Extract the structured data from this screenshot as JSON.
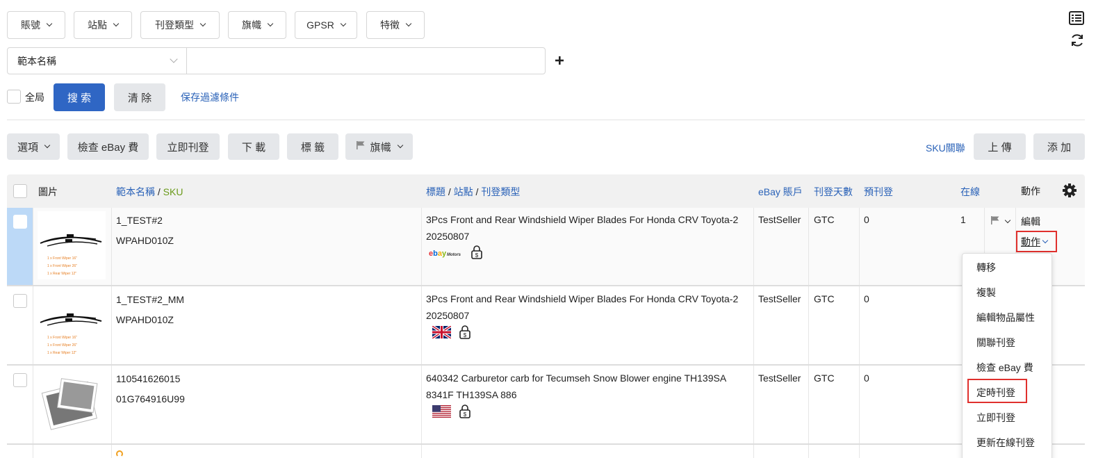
{
  "filters": {
    "dropdowns": [
      {
        "label": "賬號"
      },
      {
        "label": "站點"
      },
      {
        "label": "刊登類型"
      },
      {
        "label": "旗幟"
      },
      {
        "label": "GPSR"
      },
      {
        "label": "特徵"
      }
    ],
    "field_select": "範本名稱",
    "field_value": "",
    "global_label": "全局",
    "search_label": "搜 索",
    "clear_label": "清 除",
    "save_filter_label": "保存過濾條件"
  },
  "toolbar": {
    "options_label": "選項",
    "check_fee_label": "檢查 eBay 費",
    "publish_now_label": "立即刊登",
    "download_label": "下 載",
    "tag_label": "標 籤",
    "flag_label": "旗幟",
    "sku_link_label": "SKU關聯",
    "upload_label": "上 傳",
    "add_label": "添 加"
  },
  "table": {
    "headers": {
      "image": "圖片",
      "template": "範本名稱",
      "sep1": " / ",
      "sku": "SKU",
      "title": "標題",
      "sep2": " / ",
      "site": "站點",
      "sep3": " / ",
      "type": "刊登類型",
      "account": "eBay 賬戶",
      "days": "刊登天數",
      "pre": "預刊登",
      "online": "在線",
      "action": "動作"
    },
    "rows": [
      {
        "template": "1_TEST#2",
        "sku": "WPAHD010Z",
        "title": "3Pcs Front and Rear Windshield Wiper Blades For Honda CRV Toyota-2",
        "title2": "20250807",
        "site_icon": "ebay-motors-icon",
        "account": "TestSeller",
        "days": "GTC",
        "pre": "0",
        "online": "1",
        "edit": "編輯",
        "action": "動作"
      },
      {
        "template": "1_TEST#2_MM",
        "sku": "WPAHD010Z",
        "title": "3Pcs Front and Rear Windshield Wiper Blades For Honda CRV Toyota-2",
        "title2": "20250807",
        "site_icon": "uk-flag-icon",
        "account": "TestSeller",
        "days": "GTC",
        "pre": "0"
      },
      {
        "template": "110541626015",
        "sku": "01G764916U99",
        "title": "640342 Carburetor carb for Tecumseh Snow Blower engine TH139SA",
        "title2": "8341F TH139SA 886",
        "site_icon": "us-flag-icon",
        "account": "TestSeller",
        "days": "GTC",
        "pre": "0"
      }
    ],
    "wiper_labels": [
      "1 x Front Wiper 16\"",
      "1 x Front Wiper 26\"",
      "1 x Rear Wiper 12\""
    ]
  },
  "action_menu": {
    "items": [
      "轉移",
      "複製",
      "編輯物品屬性",
      "關聯刊登",
      "檢查 eBay 費",
      "定時刊登",
      "立即刊登",
      "更新在線刊登"
    ]
  },
  "colors": {
    "link": "#2a62b8",
    "sku_green": "#6a9a1a",
    "primary": "#2f66c4",
    "highlight": "#e0302d"
  }
}
